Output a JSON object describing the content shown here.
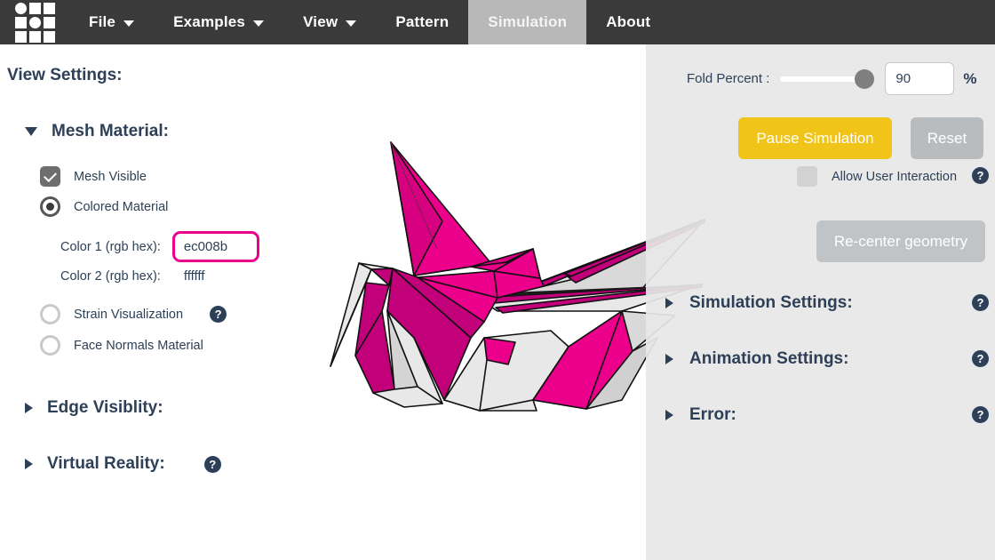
{
  "app": {
    "logo_name": "origami-simulator-logo"
  },
  "navbar": {
    "items": [
      {
        "label": "File",
        "has_caret": true,
        "active": false
      },
      {
        "label": "Examples",
        "has_caret": true,
        "active": false
      },
      {
        "label": "View",
        "has_caret": true,
        "active": false
      },
      {
        "label": "Pattern",
        "has_caret": false,
        "active": false
      },
      {
        "label": "Simulation",
        "has_caret": false,
        "active": true
      },
      {
        "label": "About",
        "has_caret": false,
        "active": false
      }
    ]
  },
  "left_panel": {
    "title": "View Settings:",
    "mesh_material": {
      "label": "Mesh Material:",
      "expanded": true,
      "mesh_visible": {
        "label": "Mesh Visible",
        "checked": true
      },
      "colored_material": {
        "label": "Colored Material",
        "selected": true
      },
      "color1": {
        "label": "Color 1 (rgb hex):",
        "value": "ec008b",
        "focused": true
      },
      "color2": {
        "label": "Color 2 (rgb hex):",
        "value": "ffffff",
        "focused": false
      },
      "strain_visualization": {
        "label": "Strain Visualization",
        "selected": false,
        "help": "?"
      },
      "face_normals_material": {
        "label": "Face Normals Material",
        "selected": false
      }
    },
    "edge_visibility": {
      "label": "Edge Visiblity:",
      "expanded": false
    },
    "virtual_reality": {
      "label": "Virtual Reality:",
      "expanded": false,
      "help": "?"
    }
  },
  "right_panel": {
    "fold_percent": {
      "label": "Fold Percent :",
      "value": "90",
      "unit": "%",
      "slider_position_percent": 90
    },
    "pause_button": "Pause Simulation",
    "reset_button": "Reset",
    "allow_user_interaction": {
      "label": "Allow User Interaction",
      "checked": false,
      "help": "?"
    },
    "recenter_button": "Re-center geometry",
    "sections": [
      {
        "label": "Simulation Settings:",
        "expanded": false,
        "help": "?"
      },
      {
        "label": "Animation Settings:",
        "expanded": false,
        "help": "?"
      },
      {
        "label": "Error:",
        "expanded": false,
        "help": "?"
      }
    ]
  },
  "colors": {
    "navbar_bg": "#3a3a3a",
    "active_tab_bg": "#b8b8b8",
    "heading_text": "#2e4057",
    "accent_magenta": "#ec008b",
    "magenta_dark": "#c2007a",
    "magenta_mid": "#d60081",
    "paper_white": "#e8e8e8",
    "panel_bg": "#e7e7e7",
    "pause_yellow": "#f0c419",
    "disabled_gray": "#b9bcbe"
  },
  "viewport": {
    "model_name": "origami-crane-3d-model"
  }
}
